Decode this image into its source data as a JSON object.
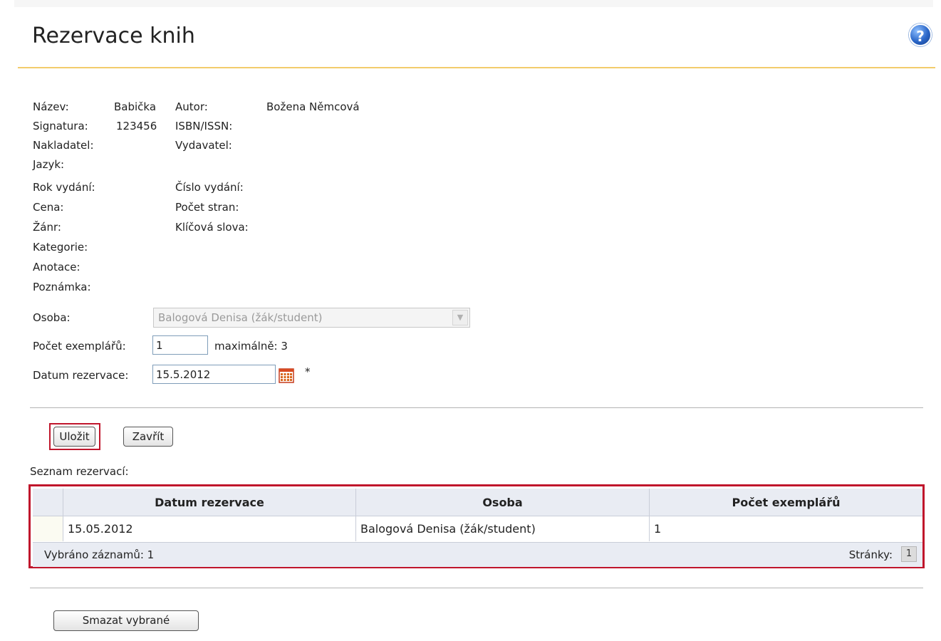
{
  "page": {
    "title": "Rezervace knih",
    "help_glyph": "?"
  },
  "book": {
    "name_label": "Název:",
    "name": "Babička",
    "author_label": "Autor:",
    "author": "Božena Němcová",
    "signature_label": "Signatura:",
    "signature": "123456",
    "isbn_label": "ISBN/ISSN:",
    "publisher_label": "Nakladatel:",
    "issuer_label": "Vydavatel:",
    "language_label": "Jazyk:",
    "year_label": "Rok vydání:",
    "edition_label": "Číslo vydání:",
    "price_label": "Cena:",
    "pages_label": "Počet stran:",
    "genre_label": "Žánr:",
    "keywords_label": "Klíčová slova:",
    "category_label": "Kategorie:",
    "annotation_label": "Anotace:",
    "note_label": "Poznámka:"
  },
  "form": {
    "person_label": "Osoba:",
    "person_value": "Balogová Denisa (žák/student)",
    "copies_label": "Počet exemplářů:",
    "copies_value": "1",
    "copies_max": "maximálně: 3",
    "date_label": "Datum rezervace:",
    "date_value": "15.5.2012",
    "required_mark": "*"
  },
  "buttons": {
    "save": "Uložit",
    "close": "Zavřít",
    "delete_selected": "Smazat vybrané"
  },
  "reservations": {
    "label": "Seznam rezervací:",
    "columns": [
      "Datum rezervace",
      "Osoba",
      "Počet exemplářů"
    ],
    "rows": [
      {
        "date": "15.05.2012",
        "person": "Balogová Denisa (žák/student)",
        "copies": "1"
      }
    ],
    "selected_count": "Vybráno záznamů: 1",
    "pages_label": "Stránky:",
    "current_page": "1"
  },
  "icons": {
    "help": "help-icon",
    "calendar": "calendar-icon",
    "dropdown": "chevron-down-icon"
  },
  "colors": {
    "accent_rule": "#f2cc6b",
    "highlight_frame": "#c0162c",
    "grid_header": "#e9ecf3"
  }
}
